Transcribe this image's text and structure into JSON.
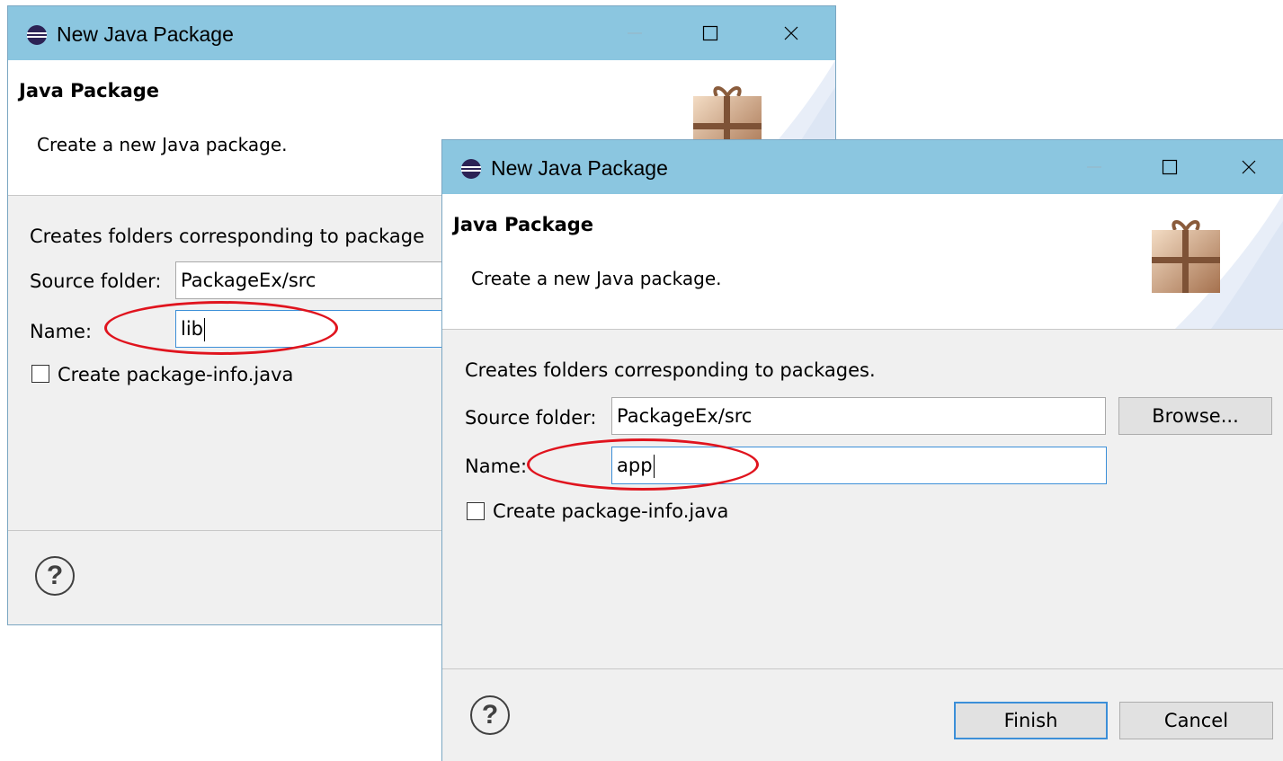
{
  "dialogs": [
    {
      "title": "New Java Package",
      "header_title": "Java Package",
      "header_desc": "Create a new Java package.",
      "body_text": "Creates folders corresponding to package",
      "source_label": "Source folder:",
      "source_value": "PackageEx/src",
      "name_label": "Name:",
      "name_value": "lib",
      "checkbox_label": "Create package-info.java",
      "help_glyph": "?"
    },
    {
      "title": "New Java Package",
      "header_title": "Java Package",
      "header_desc": "Create a new Java package.",
      "body_text": "Creates folders corresponding to packages.",
      "source_label": "Source folder:",
      "source_value": "PackageEx/src",
      "browse_label": "Browse...",
      "name_label": "Name:",
      "name_value": "app",
      "checkbox_label": "Create package-info.java",
      "finish_label": "Finish",
      "cancel_label": "Cancel",
      "help_glyph": "?"
    }
  ],
  "colors": {
    "titlebar": "#8bc6e0",
    "highlight_ellipse": "#e0141e",
    "focus_border": "#3c8fd8"
  },
  "icons": [
    "eclipse-icon",
    "minimize-icon",
    "maximize-icon",
    "close-icon",
    "package-gift-icon",
    "help-icon"
  ]
}
